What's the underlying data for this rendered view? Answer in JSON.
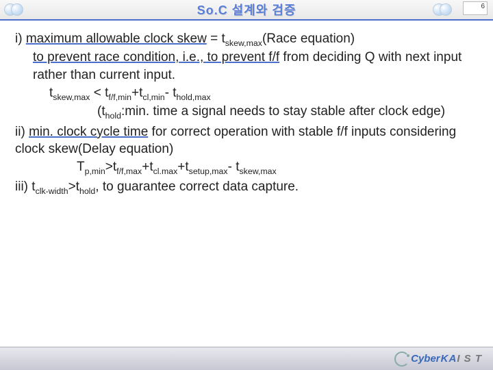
{
  "header": {
    "title": "So.C 설계와 검증",
    "page_number": "6"
  },
  "content": {
    "i_label": "i) ",
    "i_a": "maximum allowable clock skew",
    "i_b": " = t",
    "i_c": "skew,max",
    "i_d": "(Race equation)",
    "i_line2a": "to prevent race condition, i.e., to prevent f/f",
    "i_line2b": " from deciding Q with next input rather than current input.",
    "eq1_a": "t",
    "eq1_b": "skew,max",
    "eq1_c": " < t",
    "eq1_d": "f/f,min",
    "eq1_e": "+t",
    "eq1_f": "cl,min",
    "eq1_g": "- t",
    "eq1_h": "hold,max",
    "thold_a": "(t",
    "thold_b": "hold",
    "thold_c": ":min. time a signal needs to stay stable after clock edge)",
    "ii_label": "ii) ",
    "ii_a": "min. clock cycle time",
    "ii_b": " for correct operation with stable f/f inputs considering clock skew(Delay equation)",
    "eq2_a": "T",
    "eq2_b": "p,min",
    "eq2_c": ">t",
    "eq2_d": "f/f,max",
    "eq2_e": "+t",
    "eq2_f": "cl.max",
    "eq2_g": "+t",
    "eq2_h": "setup,max",
    "eq2_i": "-  t",
    "eq2_j": "skew,max",
    "iii_label": "iii) ",
    "iii_a": "t",
    "iii_b": "clk-width",
    "iii_c": ">t",
    "iii_d": "hold",
    "iii_e": ", to guarantee correct data capture."
  },
  "footer": {
    "brand1": "Cyber",
    "brand2a": "KA",
    "brand2b": "I S T"
  }
}
